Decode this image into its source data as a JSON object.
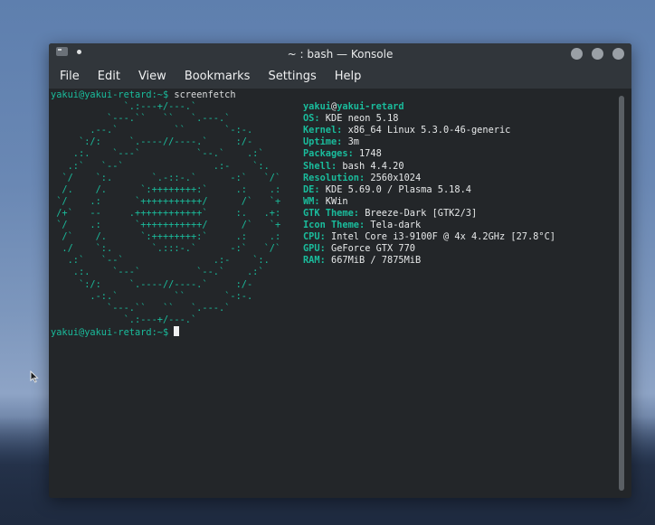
{
  "window": {
    "title": "~ : bash — Konsole"
  },
  "menu": [
    "File",
    "Edit",
    "View",
    "Bookmarks",
    "Settings",
    "Help"
  ],
  "terminal": {
    "prompt": "yakui@yakui-retard:~$",
    "command": "screenfetch",
    "user": "yakui",
    "at": "@",
    "host": "yakui-retard",
    "logo": [
      "             `.:---+/---.`",
      "          `---.``   ``   `.---.`",
      "       .--.`          ``       `-:-.",
      "     `:/:     `.----//----.`     :/-",
      "    .:.    `---`          `--.`    .:`",
      "   .:`   `--`                .:-    `:.",
      "  `/    `:.       `.-::-.`      -:`   `/`",
      "  /.    /.      `:++++++++:`     .:    .:",
      " `/    .:      `+++++++++++/      /`   `+",
      " /+`   --     .++++++++++++`     :.   .+:",
      " `/    .:      `+++++++++++/      /`   `+",
      "  /`    /.      `:++++++++:`     .:    .:",
      "  ./    `:.       `.:::-.`      -:`   `/`",
      "   .:`   `--`                .:-    `:.",
      "    .:.    `---`          `--.`    .:`",
      "     `:/:     `.----//----.`     :/-",
      "       .-:.`          ``       `-:-.",
      "          `---.``   ``   `.---.`",
      "             `.:---+/---.`"
    ],
    "info": [
      {
        "key": "OS:",
        "value": "KDE neon 5.18"
      },
      {
        "key": "Kernel:",
        "value": "x86_64 Linux 5.3.0-46-generic"
      },
      {
        "key": "Uptime:",
        "value": "3m"
      },
      {
        "key": "Packages:",
        "value": "1748"
      },
      {
        "key": "Shell:",
        "value": "bash 4.4.20"
      },
      {
        "key": "Resolution:",
        "value": "2560x1024"
      },
      {
        "key": "DE:",
        "value": "KDE 5.69.0 / Plasma 5.18.4"
      },
      {
        "key": "WM:",
        "value": "KWin"
      },
      {
        "key": "GTK Theme:",
        "value": "Breeze-Dark [GTK2/3]"
      },
      {
        "key": "Icon Theme:",
        "value": "Tela-dark"
      },
      {
        "key": "CPU:",
        "value": "Intel Core i3-9100F @ 4x 4.2GHz [27.8°C]"
      },
      {
        "key": "GPU:",
        "value": "GeForce GTX 770"
      },
      {
        "key": "RAM:",
        "value": "667MiB / 7875MiB"
      }
    ]
  },
  "colors": {
    "accent": "#1abc9c",
    "terminal_bg": "#232629",
    "chrome_bg": "#31363b"
  }
}
